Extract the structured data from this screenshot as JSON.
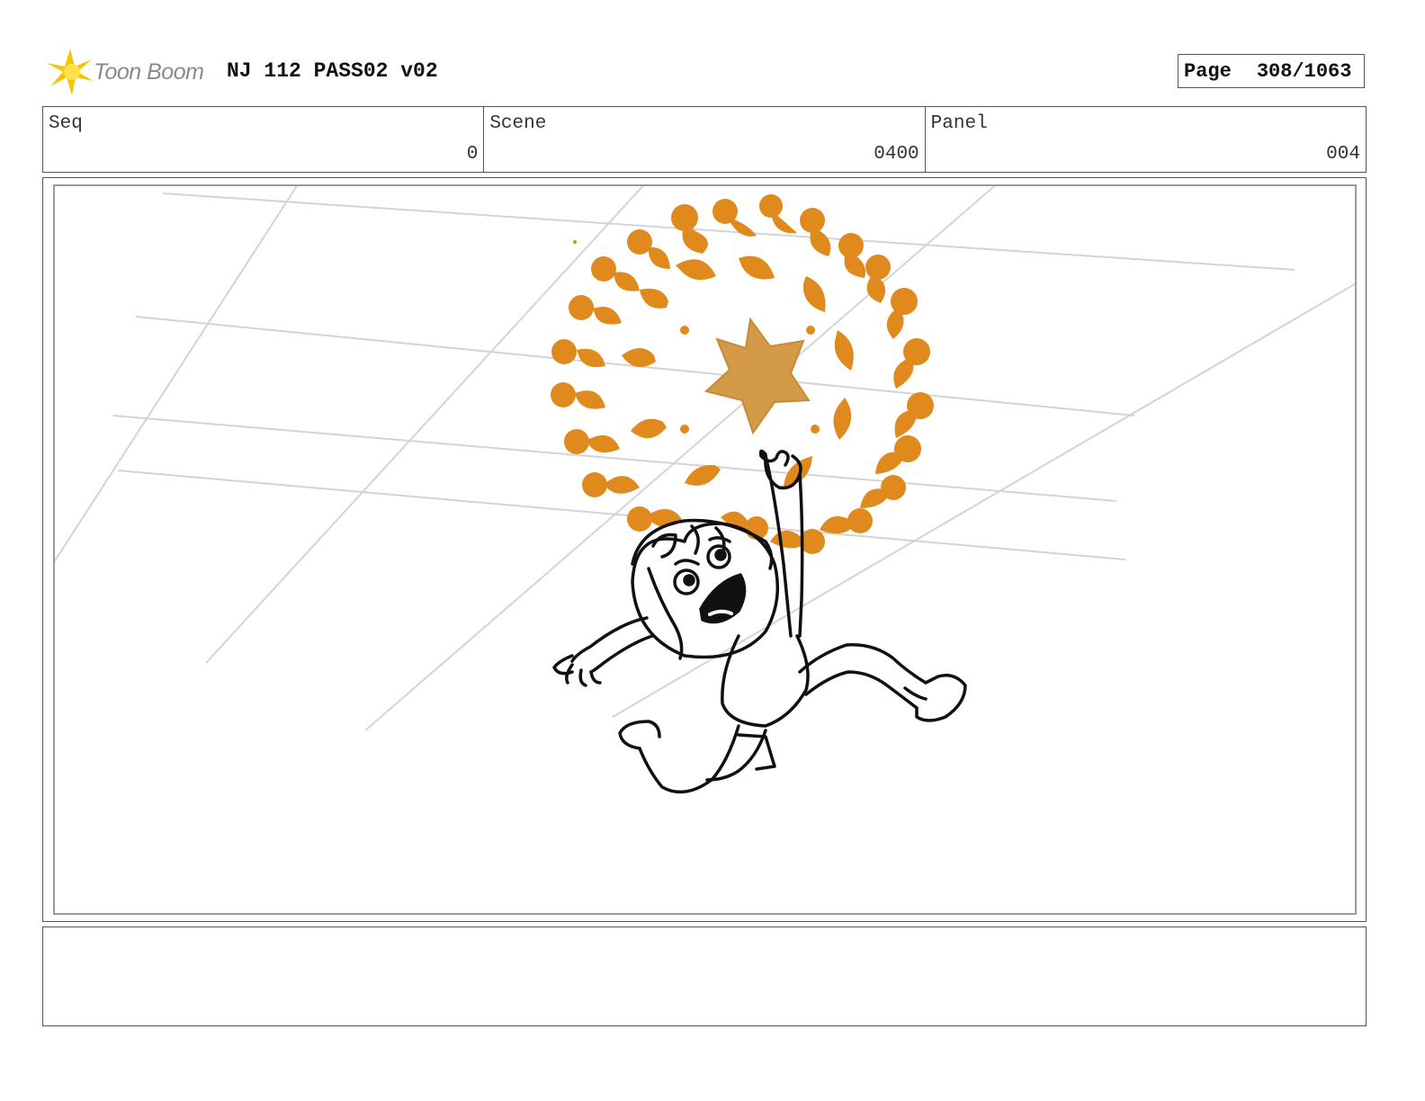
{
  "header": {
    "logo_text": "Toon Boom",
    "project_title": "NJ 112 PASS02 v02",
    "page_label": "Page",
    "page_value": "308/1063"
  },
  "info": {
    "seq_label": "Seq",
    "seq_value": "0",
    "scene_label": "Scene",
    "scene_value": "0400",
    "panel_label": "Panel",
    "panel_value": "004"
  },
  "colors": {
    "burst": "#e08a1e",
    "star": "#d39a48",
    "logo_yellow": "#f5c400"
  },
  "notes": {
    "text": ""
  }
}
